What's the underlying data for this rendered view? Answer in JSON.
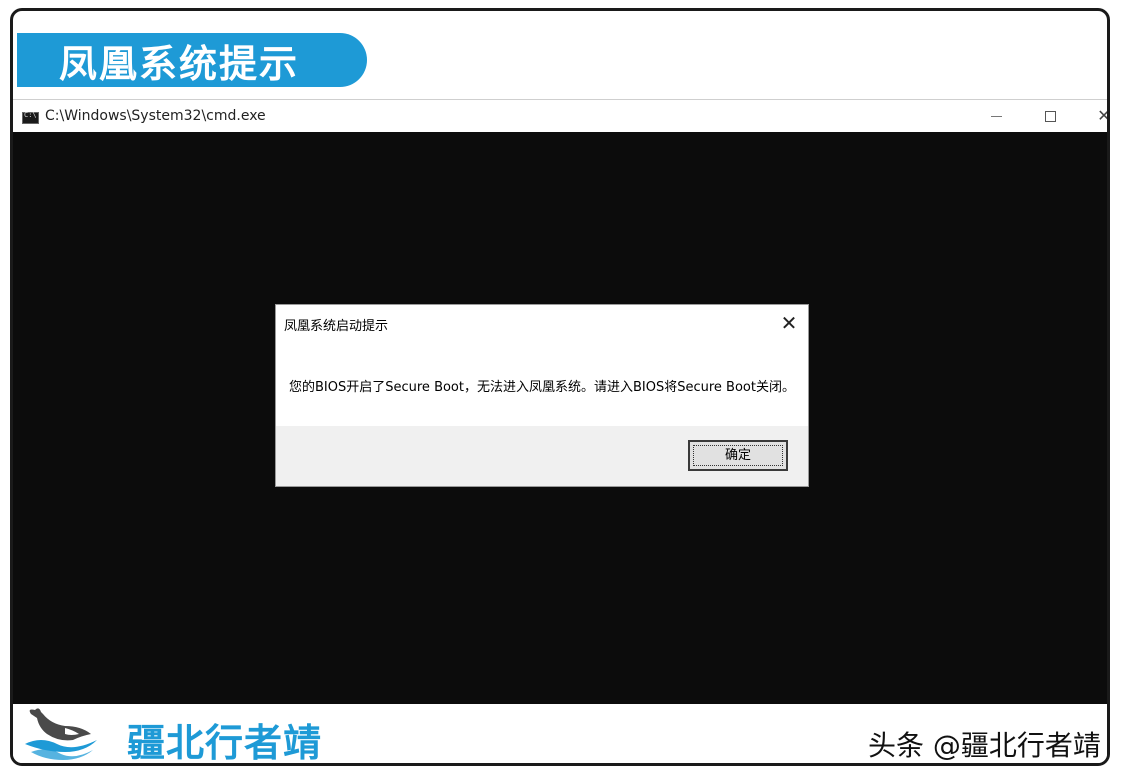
{
  "banner": {
    "title": "凤凰系统提示"
  },
  "cmd_window": {
    "title": "C:\\Windows\\System32\\cmd.exe",
    "icon": "console-icon",
    "controls": {
      "minimize": "—",
      "maximize": "☐",
      "close": "✕"
    }
  },
  "dialog": {
    "title": "凤凰系统启动提示",
    "close": "✕",
    "message": "您的BIOS开启了Secure Boot，无法进入凤凰系统。请进入BIOS将Secure Boot关闭。",
    "ok_label": "确定"
  },
  "footer": {
    "brand": "疆北行者靖",
    "credit": "头条 @疆北行者靖",
    "logo_icon": "whale-wave-logo"
  },
  "colors": {
    "accent": "#1e9ad6",
    "console_bg": "#0c0c0c",
    "dialog_footer": "#f0f0f0"
  }
}
